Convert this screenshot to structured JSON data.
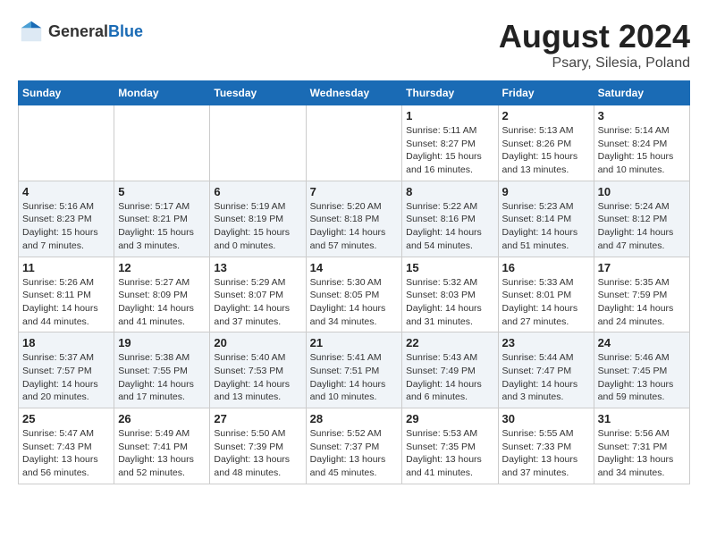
{
  "header": {
    "logo_general": "General",
    "logo_blue": "Blue",
    "month": "August 2024",
    "location": "Psary, Silesia, Poland"
  },
  "weekdays": [
    "Sunday",
    "Monday",
    "Tuesday",
    "Wednesday",
    "Thursday",
    "Friday",
    "Saturday"
  ],
  "weeks": [
    [
      {
        "day": "",
        "info": ""
      },
      {
        "day": "",
        "info": ""
      },
      {
        "day": "",
        "info": ""
      },
      {
        "day": "",
        "info": ""
      },
      {
        "day": "1",
        "info": "Sunrise: 5:11 AM\nSunset: 8:27 PM\nDaylight: 15 hours\nand 16 minutes."
      },
      {
        "day": "2",
        "info": "Sunrise: 5:13 AM\nSunset: 8:26 PM\nDaylight: 15 hours\nand 13 minutes."
      },
      {
        "day": "3",
        "info": "Sunrise: 5:14 AM\nSunset: 8:24 PM\nDaylight: 15 hours\nand 10 minutes."
      }
    ],
    [
      {
        "day": "4",
        "info": "Sunrise: 5:16 AM\nSunset: 8:23 PM\nDaylight: 15 hours\nand 7 minutes."
      },
      {
        "day": "5",
        "info": "Sunrise: 5:17 AM\nSunset: 8:21 PM\nDaylight: 15 hours\nand 3 minutes."
      },
      {
        "day": "6",
        "info": "Sunrise: 5:19 AM\nSunset: 8:19 PM\nDaylight: 15 hours\nand 0 minutes."
      },
      {
        "day": "7",
        "info": "Sunrise: 5:20 AM\nSunset: 8:18 PM\nDaylight: 14 hours\nand 57 minutes."
      },
      {
        "day": "8",
        "info": "Sunrise: 5:22 AM\nSunset: 8:16 PM\nDaylight: 14 hours\nand 54 minutes."
      },
      {
        "day": "9",
        "info": "Sunrise: 5:23 AM\nSunset: 8:14 PM\nDaylight: 14 hours\nand 51 minutes."
      },
      {
        "day": "10",
        "info": "Sunrise: 5:24 AM\nSunset: 8:12 PM\nDaylight: 14 hours\nand 47 minutes."
      }
    ],
    [
      {
        "day": "11",
        "info": "Sunrise: 5:26 AM\nSunset: 8:11 PM\nDaylight: 14 hours\nand 44 minutes."
      },
      {
        "day": "12",
        "info": "Sunrise: 5:27 AM\nSunset: 8:09 PM\nDaylight: 14 hours\nand 41 minutes."
      },
      {
        "day": "13",
        "info": "Sunrise: 5:29 AM\nSunset: 8:07 PM\nDaylight: 14 hours\nand 37 minutes."
      },
      {
        "day": "14",
        "info": "Sunrise: 5:30 AM\nSunset: 8:05 PM\nDaylight: 14 hours\nand 34 minutes."
      },
      {
        "day": "15",
        "info": "Sunrise: 5:32 AM\nSunset: 8:03 PM\nDaylight: 14 hours\nand 31 minutes."
      },
      {
        "day": "16",
        "info": "Sunrise: 5:33 AM\nSunset: 8:01 PM\nDaylight: 14 hours\nand 27 minutes."
      },
      {
        "day": "17",
        "info": "Sunrise: 5:35 AM\nSunset: 7:59 PM\nDaylight: 14 hours\nand 24 minutes."
      }
    ],
    [
      {
        "day": "18",
        "info": "Sunrise: 5:37 AM\nSunset: 7:57 PM\nDaylight: 14 hours\nand 20 minutes."
      },
      {
        "day": "19",
        "info": "Sunrise: 5:38 AM\nSunset: 7:55 PM\nDaylight: 14 hours\nand 17 minutes."
      },
      {
        "day": "20",
        "info": "Sunrise: 5:40 AM\nSunset: 7:53 PM\nDaylight: 14 hours\nand 13 minutes."
      },
      {
        "day": "21",
        "info": "Sunrise: 5:41 AM\nSunset: 7:51 PM\nDaylight: 14 hours\nand 10 minutes."
      },
      {
        "day": "22",
        "info": "Sunrise: 5:43 AM\nSunset: 7:49 PM\nDaylight: 14 hours\nand 6 minutes."
      },
      {
        "day": "23",
        "info": "Sunrise: 5:44 AM\nSunset: 7:47 PM\nDaylight: 14 hours\nand 3 minutes."
      },
      {
        "day": "24",
        "info": "Sunrise: 5:46 AM\nSunset: 7:45 PM\nDaylight: 13 hours\nand 59 minutes."
      }
    ],
    [
      {
        "day": "25",
        "info": "Sunrise: 5:47 AM\nSunset: 7:43 PM\nDaylight: 13 hours\nand 56 minutes."
      },
      {
        "day": "26",
        "info": "Sunrise: 5:49 AM\nSunset: 7:41 PM\nDaylight: 13 hours\nand 52 minutes."
      },
      {
        "day": "27",
        "info": "Sunrise: 5:50 AM\nSunset: 7:39 PM\nDaylight: 13 hours\nand 48 minutes."
      },
      {
        "day": "28",
        "info": "Sunrise: 5:52 AM\nSunset: 7:37 PM\nDaylight: 13 hours\nand 45 minutes."
      },
      {
        "day": "29",
        "info": "Sunrise: 5:53 AM\nSunset: 7:35 PM\nDaylight: 13 hours\nand 41 minutes."
      },
      {
        "day": "30",
        "info": "Sunrise: 5:55 AM\nSunset: 7:33 PM\nDaylight: 13 hours\nand 37 minutes."
      },
      {
        "day": "31",
        "info": "Sunrise: 5:56 AM\nSunset: 7:31 PM\nDaylight: 13 hours\nand 34 minutes."
      }
    ]
  ]
}
